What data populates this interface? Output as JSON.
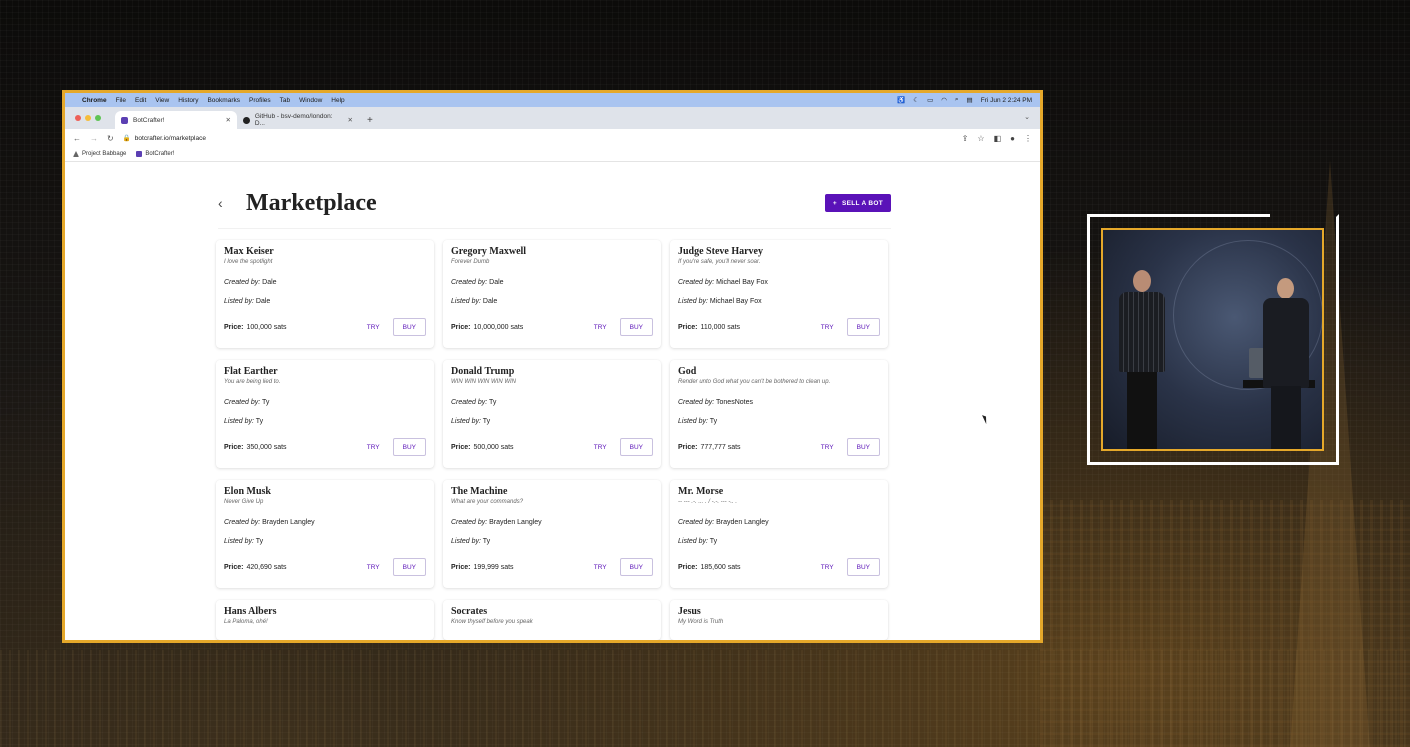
{
  "menubar": {
    "app": "Chrome",
    "items": [
      "File",
      "Edit",
      "View",
      "History",
      "Bookmarks",
      "Profiles",
      "Tab",
      "Window",
      "Help"
    ],
    "datetime": "Fri Jun 2  2:24 PM"
  },
  "tabs": [
    {
      "label": "BotCrafter!",
      "icon": "botcrafter-icon"
    },
    {
      "label": "GitHub - bsv-demo/london: D...",
      "icon": "github-icon"
    }
  ],
  "address": {
    "url": "botcrafter.io/marketplace"
  },
  "bookmarks": [
    {
      "label": "Project Babbage",
      "icon": "babbage-icon"
    },
    {
      "label": "BotCrafter!",
      "icon": "botcrafter-icon"
    }
  ],
  "page": {
    "title": "Marketplace",
    "sell_button": "SELL A BOT",
    "created_label": "Created by:",
    "listed_label": "Listed by:",
    "price_label": "Price:",
    "try_label": "TRY",
    "buy_label": "BUY"
  },
  "bots": [
    {
      "name": "Max Keiser",
      "tagline": "I love the spotlight",
      "created_by": "Dale",
      "listed_by": "Dale",
      "price": "100,000 sats"
    },
    {
      "name": "Gregory Maxwell",
      "tagline": "Forever Dumb",
      "created_by": "Dale",
      "listed_by": "Dale",
      "price": "10,000,000 sats"
    },
    {
      "name": "Judge Steve Harvey",
      "tagline": "If you're safe, you'll never soar.",
      "created_by": "Michael Bay Fox",
      "listed_by": "Michael Bay Fox",
      "price": "110,000 sats"
    },
    {
      "name": "Flat Earther",
      "tagline": "You are being lied to.",
      "created_by": "Ty",
      "listed_by": "Ty",
      "price": "350,000 sats"
    },
    {
      "name": "Donald Trump",
      "tagline": "WIN WIN WIN WIN WIN",
      "created_by": "Ty",
      "listed_by": "Ty",
      "price": "500,000 sats"
    },
    {
      "name": "God",
      "tagline": "Render unto God what you can't be bothered to clean up.",
      "created_by": "TonesNotes",
      "listed_by": "Ty",
      "price": "777,777 sats"
    },
    {
      "name": "Elon Musk",
      "tagline": "Never Give Up",
      "created_by": "Brayden Langley",
      "listed_by": "Ty",
      "price": "420,690 sats"
    },
    {
      "name": "The Machine",
      "tagline": "What are your commands?",
      "created_by": "Brayden Langley",
      "listed_by": "Ty",
      "price": "199,999 sats"
    },
    {
      "name": "Mr. Morse",
      "tagline": "-- --- .-. ... . / -.-. --- -.. .",
      "created_by": "Brayden Langley",
      "listed_by": "Ty",
      "price": "185,600 sats"
    }
  ],
  "partial_bots": [
    {
      "name": "Hans Albers",
      "tagline": "La Paloma, ohé!"
    },
    {
      "name": "Socrates",
      "tagline": "Know thyself before you speak"
    },
    {
      "name": "Jesus",
      "tagline": "My Word is Truth"
    }
  ],
  "colors": {
    "accent": "#5a12b8",
    "frame": "#e5a82a"
  }
}
